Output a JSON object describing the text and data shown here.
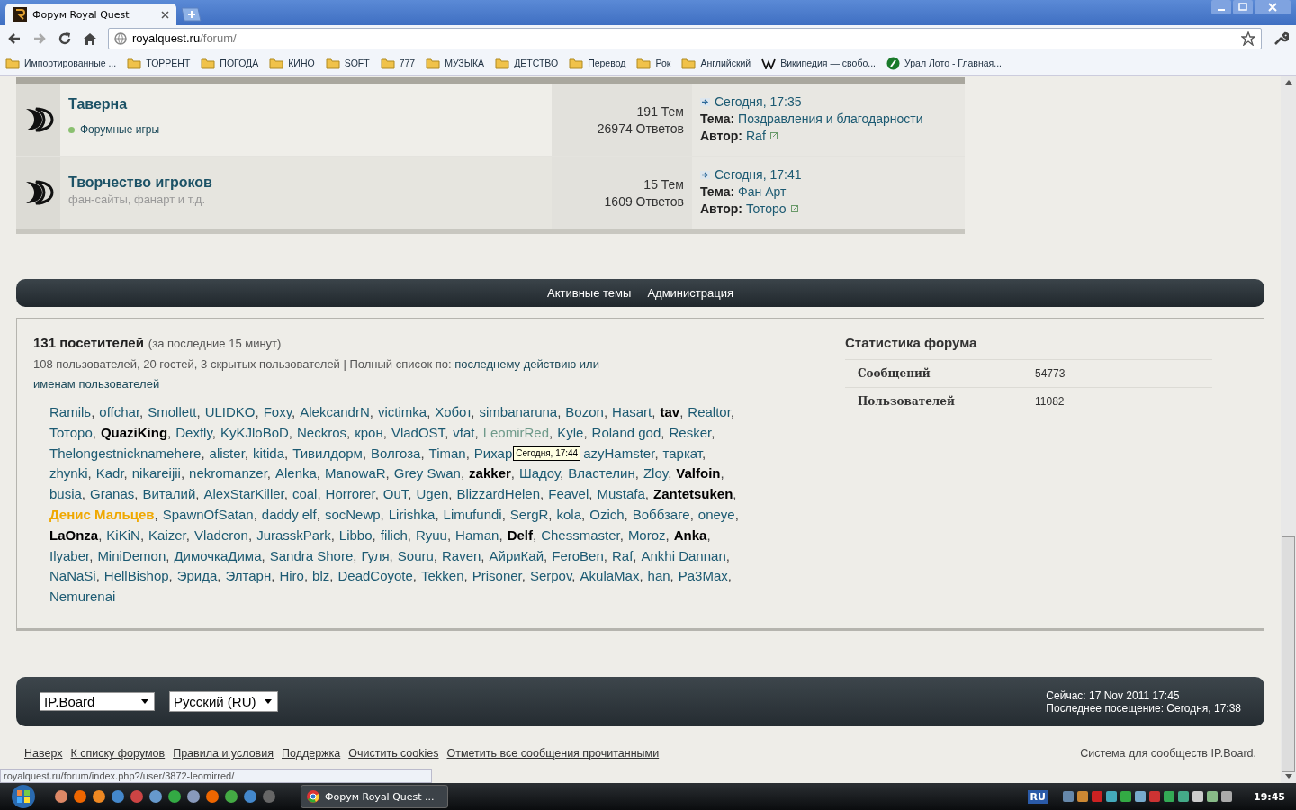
{
  "browser": {
    "tab_title": "Форум Royal Quest",
    "url_host": "royalquest.ru",
    "url_path": "/forum/",
    "bookmarks": [
      {
        "label": "Импортированные ...",
        "kind": "folder"
      },
      {
        "label": "ТОРРЕНТ",
        "kind": "folder"
      },
      {
        "label": "ПОГОДА",
        "kind": "folder"
      },
      {
        "label": "КИНО",
        "kind": "folder"
      },
      {
        "label": "SOFT",
        "kind": "folder"
      },
      {
        "label": "777",
        "kind": "folder"
      },
      {
        "label": "МУЗЫКА",
        "kind": "folder"
      },
      {
        "label": "ДЕТСТВО",
        "kind": "folder"
      },
      {
        "label": "Перевод",
        "kind": "folder"
      },
      {
        "label": "Рок",
        "kind": "folder"
      },
      {
        "label": "Английский",
        "kind": "folder"
      },
      {
        "label": "Википедия — свобо...",
        "kind": "wiki"
      },
      {
        "label": "Урал Лото - Главная...",
        "kind": "site"
      }
    ]
  },
  "forums": [
    {
      "title": "Таверна",
      "subforums": [
        "Форумные игры"
      ],
      "topics": "191 Тем",
      "replies": "26974 Ответов",
      "last_date": "Сегодня, 17:35",
      "topic_label": "Тема:",
      "topic": "Поздравления и благодарности",
      "author_label": "Автор:",
      "author": "Raf"
    },
    {
      "title": "Творчество игроков",
      "description": "фан-сайты, фанарт и т.д.",
      "topics": "15 Тем",
      "replies": "1609 Ответов",
      "last_date": "Сегодня, 17:41",
      "topic_label": "Тема:",
      "topic": "Фан Арт",
      "author_label": "Автор:",
      "author": "Тоторо"
    }
  ],
  "nav": [
    "Активные темы",
    "Администрация"
  ],
  "online": {
    "count": "131 посетителей",
    "period": "(за последние 15 минут)",
    "summary": "108 пользователей, 20 гостей, 3 скрытых пользователей | Полный список по:",
    "link1": "последнему действию",
    "or": "или",
    "link2": "именам пользователей",
    "users": [
      {
        "name": "Ramilь",
        "sep": ",",
        "kind": "user"
      },
      {
        "name": "offchar",
        "sep": ",",
        "kind": "user"
      },
      {
        "name": "Smollett",
        "sep": ",",
        "kind": "user"
      },
      {
        "name": "ULIDKO",
        "sep": ",",
        "kind": "user"
      },
      {
        "name": "Foxy",
        "sep": ",",
        "kind": "user"
      },
      {
        "name": "AlekcandrN",
        "sep": ",",
        "kind": "user"
      },
      {
        "name": "victimka",
        "sep": ",",
        "kind": "user"
      },
      {
        "name": "Хобот",
        "sep": ",",
        "kind": "user"
      },
      {
        "name": "simbanaruna",
        "sep": ",",
        "kind": "user"
      },
      {
        "name": "Bozon",
        "sep": ",",
        "kind": "user"
      },
      {
        "name": "Hasart",
        "sep": ",",
        "kind": "user"
      },
      {
        "name": "tav",
        "sep": ",",
        "kind": "bold"
      },
      {
        "name": "Realtor",
        "sep": ",",
        "kind": "user"
      },
      {
        "name": "Тоторо",
        "sep": ",",
        "kind": "user"
      },
      {
        "name": "QuaziKing",
        "sep": ",",
        "kind": "bold"
      },
      {
        "name": "Dexfly",
        "sep": ",",
        "kind": "user"
      },
      {
        "name": "KyKJloBoD",
        "sep": ",",
        "kind": "user"
      },
      {
        "name": "Neckros",
        "sep": ",",
        "kind": "user"
      },
      {
        "name": "крон",
        "sep": ",",
        "kind": "user"
      },
      {
        "name": "VladOST",
        "sep": ",",
        "kind": "user"
      },
      {
        "name": "vfat",
        "sep": ",",
        "kind": "user"
      },
      {
        "name": "LeomirRed",
        "sep": ",",
        "kind": "faded"
      },
      {
        "name": "Kyle",
        "sep": ",",
        "kind": "user"
      },
      {
        "name": "Roland god",
        "sep": ",",
        "kind": "user"
      },
      {
        "name": "Resker",
        "sep": ",",
        "kind": "user"
      },
      {
        "name": "Thelongestnicknamehere",
        "sep": ",",
        "kind": "user"
      },
      {
        "name": "alister",
        "sep": ",",
        "kind": "user"
      },
      {
        "name": "kitida",
        "sep": ",",
        "kind": "user"
      },
      {
        "name": "Тивилдорм",
        "sep": ",",
        "kind": "user"
      },
      {
        "name": "Волгоза",
        "sep": ",",
        "kind": "user"
      },
      {
        "name": "Timan",
        "sep": ",",
        "kind": "user"
      },
      {
        "name": "Рихар",
        "kind": "user"
      },
      {
        "kind": "tooltip",
        "text": "Сегодня, 17:44"
      },
      {
        "name": "azyHamster",
        "sep": ",",
        "kind": "user"
      },
      {
        "name": "таркат",
        "sep": ",",
        "kind": "user"
      },
      {
        "name": "zhynki",
        "sep": ",",
        "kind": "user"
      },
      {
        "name": "Kadr",
        "sep": ",",
        "kind": "user"
      },
      {
        "name": "nikareijii",
        "sep": ",",
        "kind": "user"
      },
      {
        "name": "nekromanzer",
        "sep": ",",
        "kind": "user"
      },
      {
        "name": "Alenka",
        "sep": ",",
        "kind": "user"
      },
      {
        "name": "ManowaR",
        "sep": ",",
        "kind": "user"
      },
      {
        "name": "Grey Swan",
        "sep": ",",
        "kind": "user"
      },
      {
        "name": "zakker",
        "sep": ",",
        "kind": "bold"
      },
      {
        "name": "Шадоу",
        "sep": ",",
        "kind": "user"
      },
      {
        "name": "Властелин",
        "sep": ",",
        "kind": "user"
      },
      {
        "name": "Zloy",
        "sep": ",",
        "kind": "user"
      },
      {
        "name": "Valfoin",
        "sep": ",",
        "kind": "bold"
      },
      {
        "name": "busia",
        "sep": ",",
        "kind": "user"
      },
      {
        "name": "Granas",
        "sep": ",",
        "kind": "user"
      },
      {
        "name": "Виталий",
        "sep": ",",
        "kind": "user"
      },
      {
        "name": "AlexStarKiller",
        "sep": ",",
        "kind": "user"
      },
      {
        "name": "coal",
        "sep": ",",
        "kind": "user"
      },
      {
        "name": "Horrorer",
        "sep": ",",
        "kind": "user"
      },
      {
        "name": "OuT",
        "sep": ",",
        "kind": "user"
      },
      {
        "name": "Ugen",
        "sep": ",",
        "kind": "user"
      },
      {
        "name": "BlizzardHelen",
        "sep": ",",
        "kind": "user"
      },
      {
        "name": "Feavel",
        "sep": ",",
        "kind": "user"
      },
      {
        "name": "Mustafa",
        "sep": ",",
        "kind": "user"
      },
      {
        "name": "Zantetsuken",
        "sep": ",",
        "kind": "bold"
      },
      {
        "name": "Денис Мальцев",
        "sep": ",",
        "kind": "highlight"
      },
      {
        "name": "SpawnOfSatan",
        "sep": ",",
        "kind": "user"
      },
      {
        "name": "daddy elf",
        "sep": ",",
        "kind": "user"
      },
      {
        "name": "socNewp",
        "sep": ",",
        "kind": "user"
      },
      {
        "name": "Lirishka",
        "sep": ",",
        "kind": "user"
      },
      {
        "name": "Limufundi",
        "sep": ",",
        "kind": "user"
      },
      {
        "name": "SergR",
        "sep": ",",
        "kind": "user"
      },
      {
        "name": "kola",
        "sep": ",",
        "kind": "user"
      },
      {
        "name": "Ozich",
        "sep": ",",
        "kind": "user"
      },
      {
        "name": "Воббзаге",
        "sep": ",",
        "kind": "user"
      },
      {
        "name": "oneye",
        "sep": ",",
        "kind": "user"
      },
      {
        "name": "LaOnza",
        "sep": ",",
        "kind": "bold"
      },
      {
        "name": "KiKiN",
        "sep": ",",
        "kind": "user"
      },
      {
        "name": "Kaizer",
        "sep": ",",
        "kind": "user"
      },
      {
        "name": "Vladeron",
        "sep": ",",
        "kind": "user"
      },
      {
        "name": "JurasskPark",
        "sep": ",",
        "kind": "user"
      },
      {
        "name": "Libbo",
        "sep": ",",
        "kind": "user"
      },
      {
        "name": "filich",
        "sep": ",",
        "kind": "user"
      },
      {
        "name": "Ryuu",
        "sep": ",",
        "kind": "user"
      },
      {
        "name": "Haman",
        "sep": ",",
        "kind": "user"
      },
      {
        "name": "Delf",
        "sep": ",",
        "kind": "bold"
      },
      {
        "name": "Chessmaster",
        "sep": ",",
        "kind": "user"
      },
      {
        "name": "Moroz",
        "sep": ",",
        "kind": "user"
      },
      {
        "name": "Anka",
        "sep": ",",
        "kind": "bold"
      },
      {
        "name": "Ilyaber",
        "sep": ",",
        "kind": "user"
      },
      {
        "name": "MiniDemon",
        "sep": ",",
        "kind": "user"
      },
      {
        "name": "ДимочкаДима",
        "sep": ",",
        "kind": "user"
      },
      {
        "name": "Sandra Shore",
        "sep": ",",
        "kind": "user"
      },
      {
        "name": "Гуля",
        "sep": ",",
        "kind": "user"
      },
      {
        "name": "Souru",
        "sep": ",",
        "kind": "user"
      },
      {
        "name": "Raven",
        "sep": ",",
        "kind": "user"
      },
      {
        "name": "АйриКай",
        "sep": ",",
        "kind": "user"
      },
      {
        "name": "FeroBen",
        "sep": ",",
        "kind": "user"
      },
      {
        "name": "Raf",
        "sep": ",",
        "kind": "user"
      },
      {
        "name": "Ankhi Dannan",
        "sep": ",",
        "kind": "user"
      },
      {
        "name": "NaNaSi",
        "sep": ",",
        "kind": "user"
      },
      {
        "name": "HellBishop",
        "sep": ",",
        "kind": "user"
      },
      {
        "name": "Эрида",
        "sep": ",",
        "kind": "user"
      },
      {
        "name": "Элтарн",
        "sep": ",",
        "kind": "user"
      },
      {
        "name": "Hiro",
        "sep": ",",
        "kind": "user"
      },
      {
        "name": "blz",
        "sep": ",",
        "kind": "user"
      },
      {
        "name": "DeadCoyote",
        "sep": ",",
        "kind": "user"
      },
      {
        "name": "Tekken",
        "sep": ",",
        "kind": "user"
      },
      {
        "name": "Prisoner",
        "sep": ",",
        "kind": "user"
      },
      {
        "name": "Serpov",
        "sep": ",",
        "kind": "user"
      },
      {
        "name": "AkulaMax",
        "sep": ",",
        "kind": "user"
      },
      {
        "name": "han",
        "sep": ",",
        "kind": "user"
      },
      {
        "name": "Pa3Max",
        "sep": ",",
        "kind": "user"
      },
      {
        "name": "Nemurenai",
        "kind": "user"
      }
    ]
  },
  "stats": {
    "title": "Статистика форума",
    "rows": [
      {
        "label": "Сообщений",
        "value": "54773"
      },
      {
        "label": "Пользователей",
        "value": "11082"
      }
    ]
  },
  "footer": {
    "skin": "IP.Board",
    "language": "Русский (RU)",
    "now": "Сейчас: 17 Nov 2011 17:45",
    "last_visit": "Последнее посещение: Сегодня, 17:38",
    "links": [
      "Наверх",
      "К списку форумов",
      "Правила и условия",
      "Поддержка",
      "Очистить cookies",
      "Отметить все сообщения прочитанными"
    ],
    "powered": "Система для сообществ IP.Board."
  },
  "status_url": "royalquest.ru/forum/index.php?/user/3872-leomirred/",
  "taskbar": {
    "window": "Форум Royal Quest ...",
    "lang": "RU",
    "clock": "19:45"
  }
}
